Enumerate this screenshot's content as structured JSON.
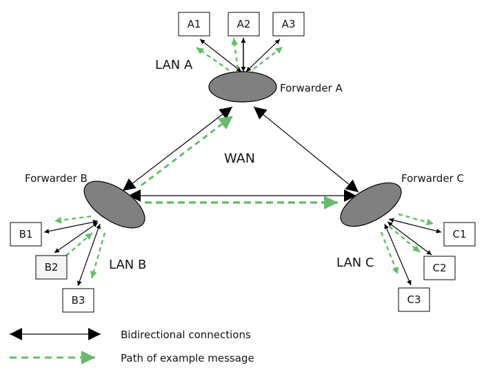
{
  "diagram": {
    "colors": {
      "connection": "#000000",
      "message_path": "#66bb6a",
      "forwarder_fill": "#808080",
      "box_fill": "#ffffff",
      "box_fill_highlight": "#f4f4f4"
    },
    "wan_label": "WAN",
    "forwarders": [
      {
        "id": "A",
        "label": "Forwarder A",
        "lan_label": "LAN A",
        "hosts": [
          "A1",
          "A2",
          "A3"
        ]
      },
      {
        "id": "B",
        "label": "Forwarder B",
        "lan_label": "LAN B",
        "hosts": [
          "B1",
          "B2",
          "B3"
        ]
      },
      {
        "id": "C",
        "label": "Forwarder C",
        "lan_label": "LAN C",
        "hosts": [
          "C1",
          "C2",
          "C3"
        ]
      }
    ],
    "wan_links": [
      {
        "from": "A",
        "to": "B",
        "type": "bidirectional"
      },
      {
        "from": "A",
        "to": "C",
        "type": "bidirectional"
      },
      {
        "from": "B",
        "to": "C",
        "type": "bidirectional"
      }
    ],
    "message_path": [
      {
        "from": "B2",
        "to": "B"
      },
      {
        "from": "B",
        "to": "B1"
      },
      {
        "from": "B",
        "to": "B3"
      },
      {
        "from": "B",
        "to": "A"
      },
      {
        "from": "A",
        "to": "A1"
      },
      {
        "from": "A",
        "to": "A2"
      },
      {
        "from": "A",
        "to": "A3"
      },
      {
        "from": "B",
        "to": "C"
      },
      {
        "from": "C",
        "to": "C1"
      },
      {
        "from": "C",
        "to": "C2"
      },
      {
        "from": "C",
        "to": "C3"
      }
    ]
  },
  "legend": {
    "items": [
      {
        "label": "Bidirectional connections",
        "kind": "bidirectional"
      },
      {
        "label": "Path of example message",
        "kind": "message"
      }
    ]
  }
}
